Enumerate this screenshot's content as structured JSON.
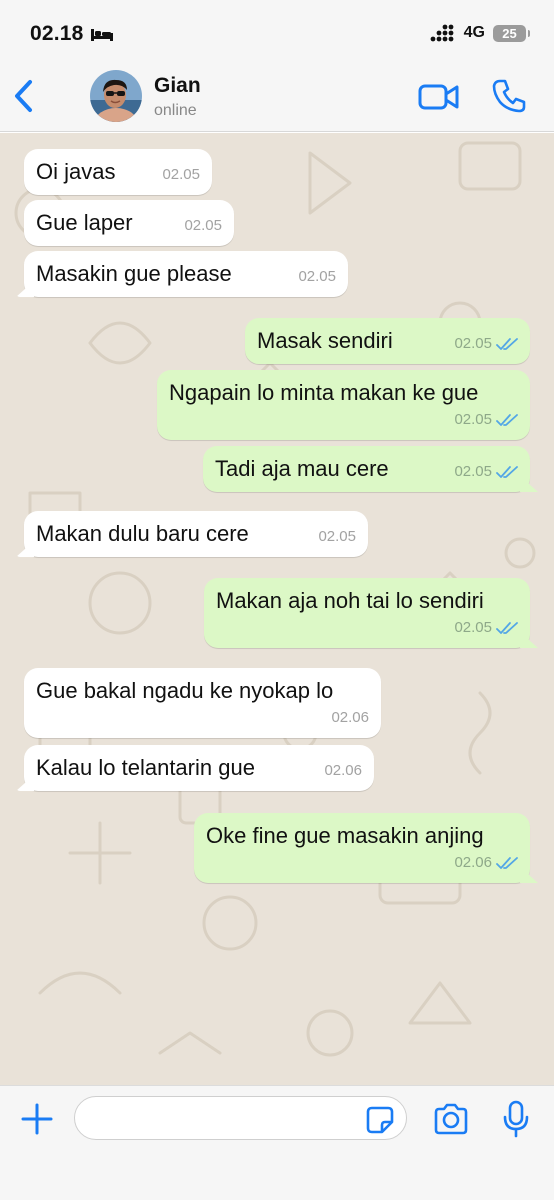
{
  "status_bar": {
    "time": "02.18",
    "network": "4G",
    "battery": "25"
  },
  "header": {
    "contact_name": "Gian",
    "contact_status": "online"
  },
  "messages": [
    {
      "direction": "in",
      "text": "Oi javas",
      "time": "02.05"
    },
    {
      "direction": "in",
      "text": "Gue laper",
      "time": "02.05"
    },
    {
      "direction": "in",
      "text": "Masakin gue please",
      "time": "02.05"
    },
    {
      "direction": "out",
      "text": "Masak sendiri",
      "time": "02.05",
      "read": true
    },
    {
      "direction": "out",
      "text": "Ngapain lo minta makan ke gue",
      "time": "02.05",
      "read": true
    },
    {
      "direction": "out",
      "text": "Tadi aja mau cere",
      "time": "02.05",
      "read": true
    },
    {
      "direction": "in",
      "text": "Makan dulu baru cere",
      "time": "02.05"
    },
    {
      "direction": "out",
      "text": "Makan aja noh tai lo sendiri",
      "time": "02.05",
      "read": true
    },
    {
      "direction": "in",
      "text": "Gue bakal ngadu ke nyokap lo",
      "time": "02.06"
    },
    {
      "direction": "in",
      "text": "Kalau lo telantarin gue",
      "time": "02.06"
    },
    {
      "direction": "out",
      "text": "Oke fine gue masakin anjing",
      "time": "02.06",
      "read": true
    }
  ],
  "input": {
    "value": "",
    "placeholder": ""
  },
  "icons": {
    "back": "chevron-left-icon",
    "video": "video-camera-icon",
    "call": "phone-icon",
    "plus": "plus-icon",
    "sticker": "sticker-icon",
    "camera": "camera-icon",
    "mic": "microphone-icon",
    "read_receipt": "double-check-icon"
  },
  "colors": {
    "accent": "#1a7cf4",
    "outgoing_bubble": "#dcf8c6",
    "incoming_bubble": "#ffffff",
    "chat_background": "#e9e2d8",
    "read_tick": "#53a6e6"
  }
}
